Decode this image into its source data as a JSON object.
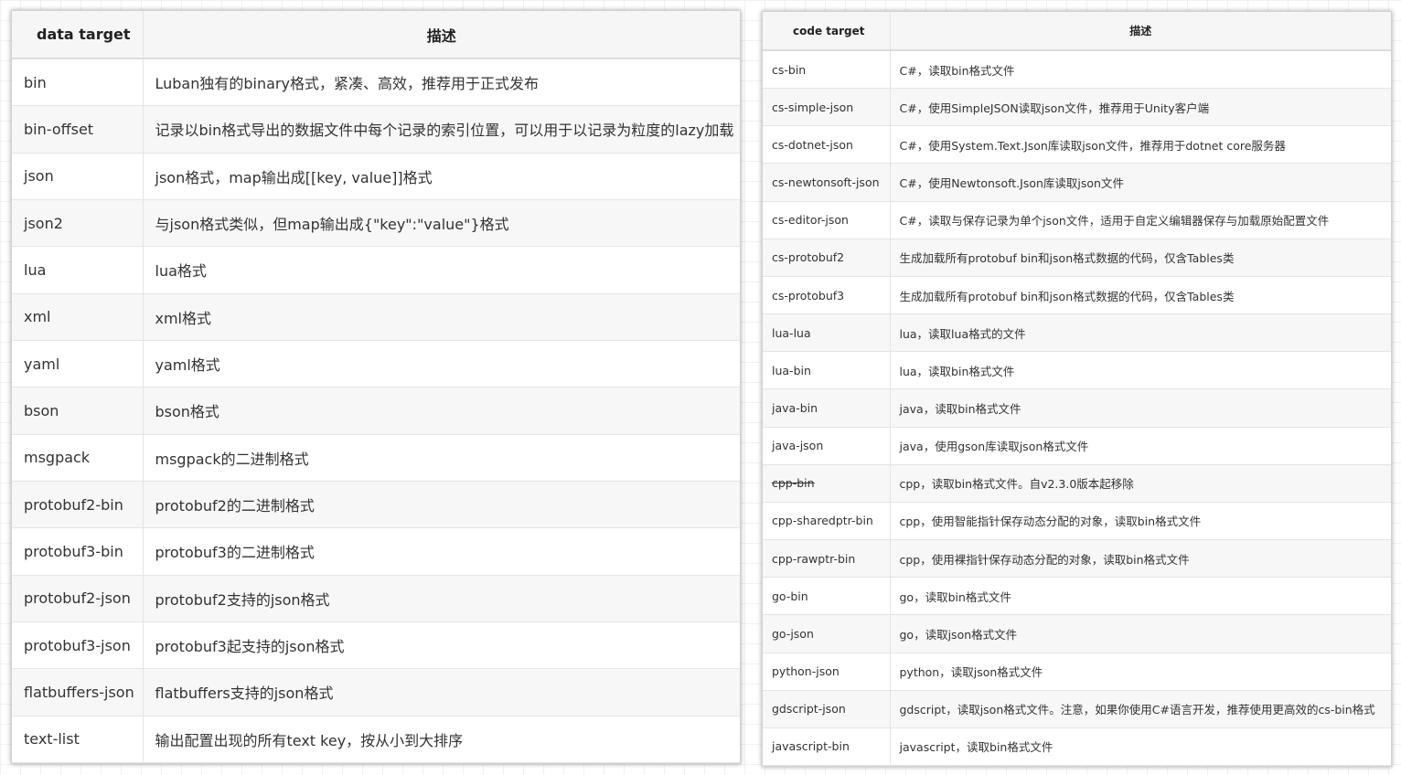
{
  "data_table": {
    "header_name": "data target",
    "header_desc": "描述",
    "rows": [
      {
        "name": "bin",
        "desc": "Luban独有的binary格式，紧凑、高效，推荐用于正式发布"
      },
      {
        "name": "bin-offset",
        "desc": "记录以bin格式导出的数据文件中每个记录的索引位置，可以用于以记录为粒度的lazy加载"
      },
      {
        "name": "json",
        "desc": "json格式，map输出成[[key, value]]格式"
      },
      {
        "name": "json2",
        "desc": "与json格式类似，但map输出成{\"key\":\"value\"}格式"
      },
      {
        "name": "lua",
        "desc": "lua格式"
      },
      {
        "name": "xml",
        "desc": "xml格式"
      },
      {
        "name": "yaml",
        "desc": "yaml格式"
      },
      {
        "name": "bson",
        "desc": "bson格式"
      },
      {
        "name": "msgpack",
        "desc": "msgpack的二进制格式"
      },
      {
        "name": "protobuf2-bin",
        "desc": "protobuf2的二进制格式"
      },
      {
        "name": "protobuf3-bin",
        "desc": "protobuf3的二进制格式"
      },
      {
        "name": "protobuf2-json",
        "desc": "protobuf2支持的json格式"
      },
      {
        "name": "protobuf3-json",
        "desc": "protobuf3起支持的json格式"
      },
      {
        "name": "flatbuffers-json",
        "desc": "flatbuffers支持的json格式"
      },
      {
        "name": "text-list",
        "desc": "输出配置出现的所有text key，按从小到大排序"
      }
    ]
  },
  "code_table": {
    "header_name": "code target",
    "header_desc": "描述",
    "rows": [
      {
        "name": "cs-bin",
        "desc": "C#，读取bin格式文件"
      },
      {
        "name": "cs-simple-json",
        "desc": "C#，使用SimpleJSON读取json文件，推荐用于Unity客户端"
      },
      {
        "name": "cs-dotnet-json",
        "desc": "C#，使用System.Text.Json库读取json文件，推荐用于dotnet core服务器"
      },
      {
        "name": "cs-newtonsoft-json",
        "desc": "C#，使用Newtonsoft.Json库读取json文件"
      },
      {
        "name": "cs-editor-json",
        "desc": "C#，读取与保存记录为单个json文件，适用于自定义编辑器保存与加载原始配置文件"
      },
      {
        "name": "cs-protobuf2",
        "desc": "生成加载所有protobuf bin和json格式数据的代码，仅含Tables类"
      },
      {
        "name": "cs-protobuf3",
        "desc": "生成加载所有protobuf bin和json格式数据的代码，仅含Tables类"
      },
      {
        "name": "lua-lua",
        "desc": "lua，读取lua格式的文件"
      },
      {
        "name": "lua-bin",
        "desc": "lua，读取bin格式文件"
      },
      {
        "name": "java-bin",
        "desc": "java，读取bin格式文件"
      },
      {
        "name": "java-json",
        "desc": "java，使用gson库读取json格式文件"
      },
      {
        "name": "cpp-bin",
        "desc": "cpp，读取bin格式文件。自v2.3.0版本起移除",
        "strike": true
      },
      {
        "name": "cpp-sharedptr-bin",
        "desc": "cpp，使用智能指针保存动态分配的对象，读取bin格式文件"
      },
      {
        "name": "cpp-rawptr-bin",
        "desc": "cpp，使用裸指针保存动态分配的对象，读取bin格式文件"
      },
      {
        "name": "go-bin",
        "desc": "go，读取bin格式文件"
      },
      {
        "name": "go-json",
        "desc": "go，读取json格式文件"
      },
      {
        "name": "python-json",
        "desc": "python，读取json格式文件"
      },
      {
        "name": "gdscript-json",
        "desc": "gdscript，读取json格式文件。注意，如果你使用C#语言开发，推荐使用更高效的cs-bin格式"
      },
      {
        "name": "javascript-bin",
        "desc": "javascript，读取bin格式文件"
      }
    ]
  }
}
